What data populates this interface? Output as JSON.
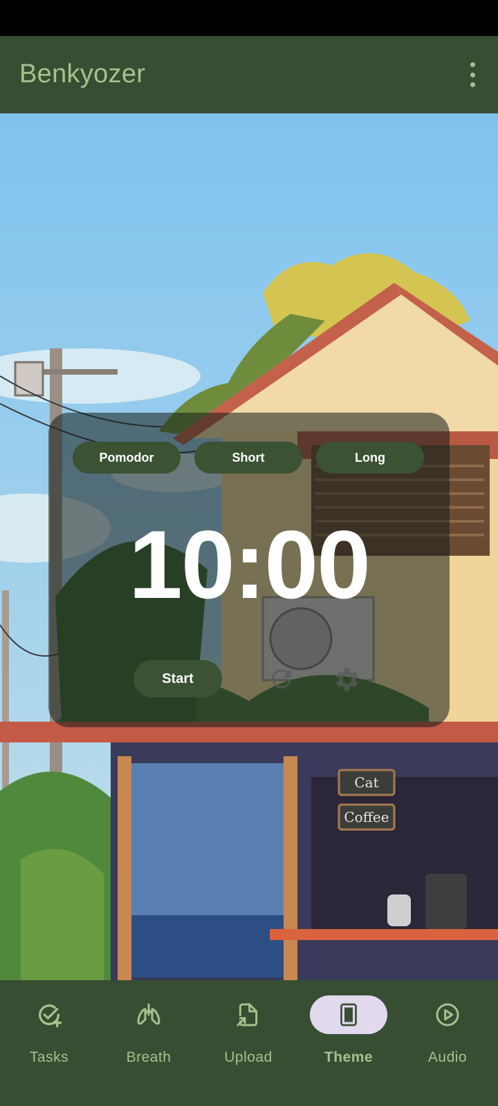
{
  "app": {
    "title": "Benkyozer"
  },
  "timer": {
    "modes": [
      "Pomodor",
      "Short",
      "Long"
    ],
    "display": "10:00",
    "start_label": "Start"
  },
  "scene": {
    "sign_cat": "Cat",
    "sign_coffee": "Coffee"
  },
  "nav": {
    "items": [
      {
        "label": "Tasks",
        "icon": "task-add-icon",
        "active": false
      },
      {
        "label": "Breath",
        "icon": "lungs-icon",
        "active": false
      },
      {
        "label": "Upload",
        "icon": "upload-file-icon",
        "active": false
      },
      {
        "label": "Theme",
        "icon": "theme-phone-icon",
        "active": true
      },
      {
        "label": "Audio",
        "icon": "play-circle-icon",
        "active": false
      }
    ]
  },
  "colors": {
    "bar": "#374e32",
    "accent": "#a9c08e",
    "button": "#3b5233",
    "active_pill": "#e2d9ef"
  }
}
